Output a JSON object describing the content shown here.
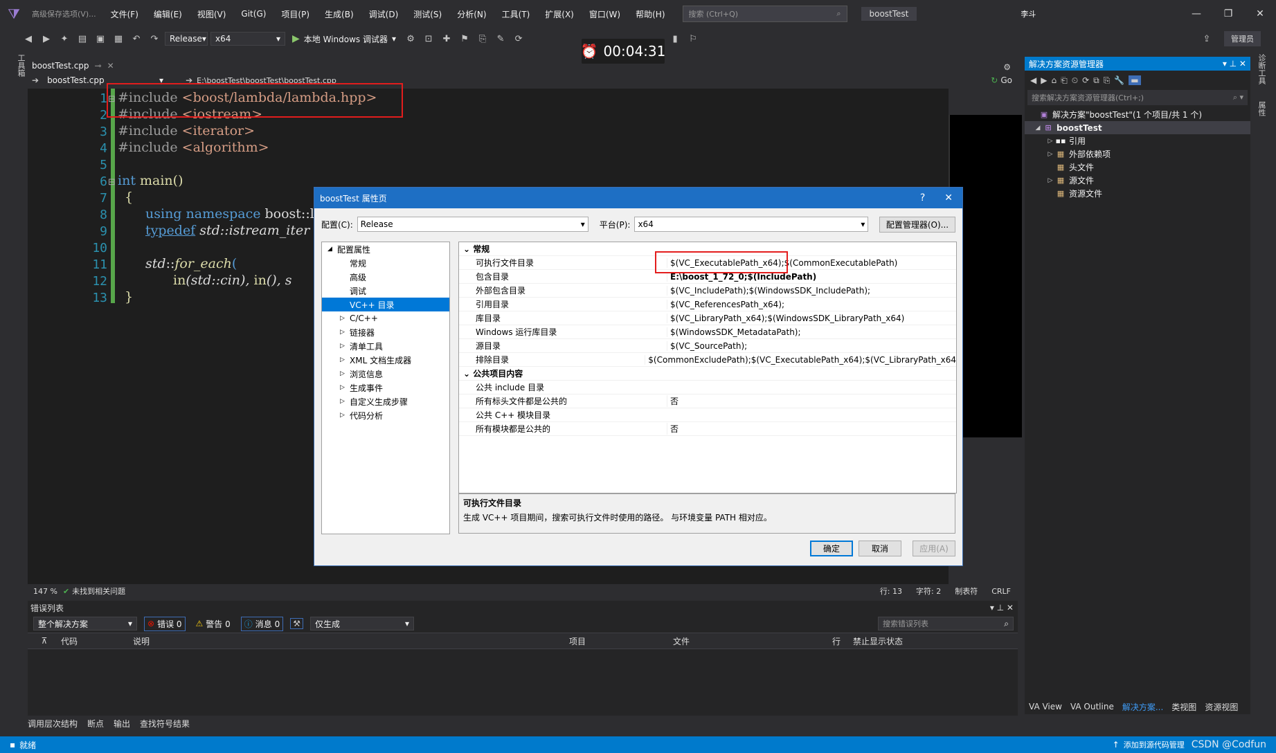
{
  "menubar": {
    "hint": "高级保存选项(V)...",
    "items": [
      "文件(F)",
      "编辑(E)",
      "视图(V)",
      "Git(G)",
      "项目(P)",
      "生成(B)",
      "调试(D)",
      "测试(S)",
      "分析(N)",
      "工具(T)",
      "扩展(X)",
      "窗口(W)",
      "帮助(H)"
    ],
    "search_placeholder": "搜索 (Ctrl+Q)",
    "window_title": "boostTest",
    "user_badge": "李斗",
    "admin": "管理员"
  },
  "toolbar": {
    "config": "Release",
    "platform": "x64",
    "run_label": "本地 Windows 调试器"
  },
  "timer": "00:04:31",
  "left_tab": "工具箱",
  "editor": {
    "tab_name": "boostTest.cpp",
    "nav_scope": "boostTest.cpp",
    "nav_path": "E:\\boostTest\\boostTest\\boostTest.cpp",
    "go_label": "Go",
    "line_numbers": [
      "1",
      "2",
      "3",
      "4",
      "5",
      "6",
      "7",
      "8",
      "9",
      "10",
      "11",
      "12",
      "13"
    ],
    "code": {
      "l1_kw": "#include",
      "l1_str": " <boost/lambda/lambda.hpp>",
      "l2_kw": "#include",
      "l2_str": " <iostream>",
      "l3_kw": "#include",
      "l3_str": " <iterator>",
      "l4_kw": "#include",
      "l4_str": " <algorithm>",
      "l6_kw": "int",
      "l6_fn": " main()",
      "l7": "{",
      "l8_kw": "using namespace",
      "l8_rest": " boost::la",
      "l9_kw": "typedef",
      "l9_rest": " std::istream_iter",
      "l11_ns": "std",
      "l11_sep": "::",
      "l11_fn": "for_each",
      "l11_p": "(",
      "l12_a": "in",
      "l12_b": "(std::cin), ",
      "l12_c": "in",
      "l12_d": "(), s",
      "l13": "}"
    }
  },
  "statusline": {
    "zoom": "147 %",
    "issues": "未找到相关问题",
    "line": "行: 13",
    "char": "字符: 2",
    "tab": "制表符",
    "eol": "CRLF"
  },
  "errorlist": {
    "title": "错误列表",
    "scope": "整个解决方案",
    "errors": "错误 0",
    "warnings": "警告 0",
    "messages": "消息 0",
    "filter": "仅生成",
    "search_placeholder": "搜索错误列表",
    "columns": [
      "代码",
      "说明",
      "项目",
      "文件",
      "行",
      "禁止显示状态"
    ]
  },
  "bottom_tabs": [
    "调用层次结构",
    "断点",
    "输出",
    "查找符号结果"
  ],
  "statusbar": {
    "ready": "就绪",
    "right": "添加到源代码管理",
    "watermark": "CSDN @Codfun"
  },
  "solution": {
    "title": "解决方案资源管理器",
    "search_placeholder": "搜索解决方案资源管理器(Ctrl+;)",
    "tree": [
      {
        "label": "解决方案\"boostTest\"(1 个项目/共 1 个)",
        "indent": 0,
        "arrow": "",
        "icon": "solution-icon"
      },
      {
        "label": "boostTest",
        "indent": 1,
        "arrow": "◢",
        "icon": "project-icon",
        "bold": true
      },
      {
        "label": "引用",
        "indent": 2,
        "arrow": "▷",
        "icon": "references-icon"
      },
      {
        "label": "外部依赖项",
        "indent": 2,
        "arrow": "▷",
        "icon": "external-deps-icon"
      },
      {
        "label": "头文件",
        "indent": 2,
        "arrow": "",
        "icon": "folder-icon"
      },
      {
        "label": "源文件",
        "indent": 2,
        "arrow": "▷",
        "icon": "folder-icon"
      },
      {
        "label": "资源文件",
        "indent": 2,
        "arrow": "",
        "icon": "folder-icon"
      }
    ],
    "tabs": [
      "VA View",
      "VA Outline",
      "解决方案...",
      "类视图",
      "资源视图"
    ],
    "right_tabs": [
      "诊断工具",
      "属性"
    ]
  },
  "dialog": {
    "title": "boostTest 属性页",
    "help": "?",
    "config_label": "配置(C):",
    "config_value": "Release",
    "platform_label": "平台(P):",
    "platform_value": "x64",
    "config_manager": "配置管理器(O)...",
    "tree": [
      {
        "label": "配置属性",
        "level": 0,
        "arrow": "◢"
      },
      {
        "label": "常规",
        "level": 1,
        "arrow": ""
      },
      {
        "label": "高级",
        "level": 1,
        "arrow": ""
      },
      {
        "label": "调试",
        "level": 1,
        "arrow": ""
      },
      {
        "label": "VC++ 目录",
        "level": 1,
        "arrow": "",
        "selected": true
      },
      {
        "label": "C/C++",
        "level": 1,
        "arrow": "▷"
      },
      {
        "label": "链接器",
        "level": 1,
        "arrow": "▷"
      },
      {
        "label": "清单工具",
        "level": 1,
        "arrow": "▷"
      },
      {
        "label": "XML 文档生成器",
        "level": 1,
        "arrow": "▷"
      },
      {
        "label": "浏览信息",
        "level": 1,
        "arrow": "▷"
      },
      {
        "label": "生成事件",
        "level": 1,
        "arrow": "▷"
      },
      {
        "label": "自定义生成步骤",
        "level": 1,
        "arrow": "▷"
      },
      {
        "label": "代码分析",
        "level": 1,
        "arrow": "▷"
      }
    ],
    "grid": [
      {
        "section": true,
        "key": "常规",
        "value": ""
      },
      {
        "key": "可执行文件目录",
        "value": "$(VC_ExecutablePath_x64);$(CommonExecutablePath)"
      },
      {
        "key": "包含目录",
        "value": "E:\\boost_1_72_0;$(IncludePath)",
        "bold": true
      },
      {
        "key": "外部包含目录",
        "value": "$(VC_IncludePath);$(WindowsSDK_IncludePath);"
      },
      {
        "key": "引用目录",
        "value": "$(VC_ReferencesPath_x64);"
      },
      {
        "key": "库目录",
        "value": "$(VC_LibraryPath_x64);$(WindowsSDK_LibraryPath_x64)"
      },
      {
        "key": "Windows 运行库目录",
        "value": "$(WindowsSDK_MetadataPath);"
      },
      {
        "key": "源目录",
        "value": "$(VC_SourcePath);"
      },
      {
        "key": "排除目录",
        "value": "$(CommonExcludePath);$(VC_ExecutablePath_x64);$(VC_LibraryPath_x64"
      },
      {
        "section": true,
        "key": "公共项目内容",
        "value": ""
      },
      {
        "key": "公共 include 目录",
        "value": ""
      },
      {
        "key": "所有标头文件都是公共的",
        "value": "否"
      },
      {
        "key": "公共 C++ 模块目录",
        "value": ""
      },
      {
        "key": "所有模块都是公共的",
        "value": "否"
      }
    ],
    "desc_title": "可执行文件目录",
    "desc_text": "生成 VC++ 项目期间，搜索可执行文件时使用的路径。 与环境变量 PATH 相对应。",
    "ok": "确定",
    "cancel": "取消",
    "apply": "应用(A)"
  }
}
